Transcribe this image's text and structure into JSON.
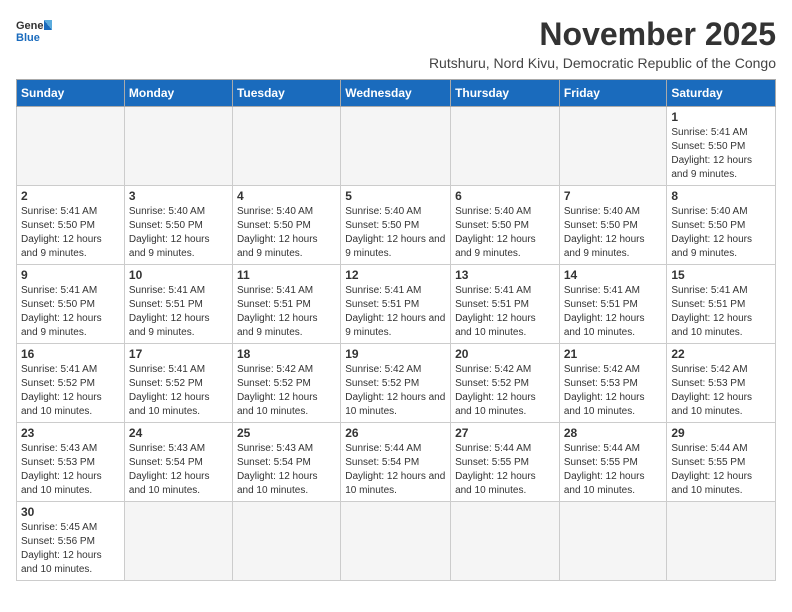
{
  "logo": {
    "line1": "General",
    "line2": "Blue"
  },
  "title": "November 2025",
  "subtitle": "Rutshuru, Nord Kivu, Democratic Republic of the Congo",
  "weekdays": [
    "Sunday",
    "Monday",
    "Tuesday",
    "Wednesday",
    "Thursday",
    "Friday",
    "Saturday"
  ],
  "weeks": [
    [
      {
        "day": "",
        "info": ""
      },
      {
        "day": "",
        "info": ""
      },
      {
        "day": "",
        "info": ""
      },
      {
        "day": "",
        "info": ""
      },
      {
        "day": "",
        "info": ""
      },
      {
        "day": "",
        "info": ""
      },
      {
        "day": "1",
        "info": "Sunrise: 5:41 AM\nSunset: 5:50 PM\nDaylight: 12 hours and 9 minutes."
      }
    ],
    [
      {
        "day": "2",
        "info": "Sunrise: 5:41 AM\nSunset: 5:50 PM\nDaylight: 12 hours and 9 minutes."
      },
      {
        "day": "3",
        "info": "Sunrise: 5:40 AM\nSunset: 5:50 PM\nDaylight: 12 hours and 9 minutes."
      },
      {
        "day": "4",
        "info": "Sunrise: 5:40 AM\nSunset: 5:50 PM\nDaylight: 12 hours and 9 minutes."
      },
      {
        "day": "5",
        "info": "Sunrise: 5:40 AM\nSunset: 5:50 PM\nDaylight: 12 hours and 9 minutes."
      },
      {
        "day": "6",
        "info": "Sunrise: 5:40 AM\nSunset: 5:50 PM\nDaylight: 12 hours and 9 minutes."
      },
      {
        "day": "7",
        "info": "Sunrise: 5:40 AM\nSunset: 5:50 PM\nDaylight: 12 hours and 9 minutes."
      },
      {
        "day": "8",
        "info": "Sunrise: 5:40 AM\nSunset: 5:50 PM\nDaylight: 12 hours and 9 minutes."
      }
    ],
    [
      {
        "day": "9",
        "info": "Sunrise: 5:41 AM\nSunset: 5:50 PM\nDaylight: 12 hours and 9 minutes."
      },
      {
        "day": "10",
        "info": "Sunrise: 5:41 AM\nSunset: 5:51 PM\nDaylight: 12 hours and 9 minutes."
      },
      {
        "day": "11",
        "info": "Sunrise: 5:41 AM\nSunset: 5:51 PM\nDaylight: 12 hours and 9 minutes."
      },
      {
        "day": "12",
        "info": "Sunrise: 5:41 AM\nSunset: 5:51 PM\nDaylight: 12 hours and 9 minutes."
      },
      {
        "day": "13",
        "info": "Sunrise: 5:41 AM\nSunset: 5:51 PM\nDaylight: 12 hours and 10 minutes."
      },
      {
        "day": "14",
        "info": "Sunrise: 5:41 AM\nSunset: 5:51 PM\nDaylight: 12 hours and 10 minutes."
      },
      {
        "day": "15",
        "info": "Sunrise: 5:41 AM\nSunset: 5:51 PM\nDaylight: 12 hours and 10 minutes."
      }
    ],
    [
      {
        "day": "16",
        "info": "Sunrise: 5:41 AM\nSunset: 5:52 PM\nDaylight: 12 hours and 10 minutes."
      },
      {
        "day": "17",
        "info": "Sunrise: 5:41 AM\nSunset: 5:52 PM\nDaylight: 12 hours and 10 minutes."
      },
      {
        "day": "18",
        "info": "Sunrise: 5:42 AM\nSunset: 5:52 PM\nDaylight: 12 hours and 10 minutes."
      },
      {
        "day": "19",
        "info": "Sunrise: 5:42 AM\nSunset: 5:52 PM\nDaylight: 12 hours and 10 minutes."
      },
      {
        "day": "20",
        "info": "Sunrise: 5:42 AM\nSunset: 5:52 PM\nDaylight: 12 hours and 10 minutes."
      },
      {
        "day": "21",
        "info": "Sunrise: 5:42 AM\nSunset: 5:53 PM\nDaylight: 12 hours and 10 minutes."
      },
      {
        "day": "22",
        "info": "Sunrise: 5:42 AM\nSunset: 5:53 PM\nDaylight: 12 hours and 10 minutes."
      }
    ],
    [
      {
        "day": "23",
        "info": "Sunrise: 5:43 AM\nSunset: 5:53 PM\nDaylight: 12 hours and 10 minutes."
      },
      {
        "day": "24",
        "info": "Sunrise: 5:43 AM\nSunset: 5:54 PM\nDaylight: 12 hours and 10 minutes."
      },
      {
        "day": "25",
        "info": "Sunrise: 5:43 AM\nSunset: 5:54 PM\nDaylight: 12 hours and 10 minutes."
      },
      {
        "day": "26",
        "info": "Sunrise: 5:44 AM\nSunset: 5:54 PM\nDaylight: 12 hours and 10 minutes."
      },
      {
        "day": "27",
        "info": "Sunrise: 5:44 AM\nSunset: 5:55 PM\nDaylight: 12 hours and 10 minutes."
      },
      {
        "day": "28",
        "info": "Sunrise: 5:44 AM\nSunset: 5:55 PM\nDaylight: 12 hours and 10 minutes."
      },
      {
        "day": "29",
        "info": "Sunrise: 5:44 AM\nSunset: 5:55 PM\nDaylight: 12 hours and 10 minutes."
      }
    ],
    [
      {
        "day": "30",
        "info": "Sunrise: 5:45 AM\nSunset: 5:56 PM\nDaylight: 12 hours and 10 minutes."
      },
      {
        "day": "",
        "info": ""
      },
      {
        "day": "",
        "info": ""
      },
      {
        "day": "",
        "info": ""
      },
      {
        "day": "",
        "info": ""
      },
      {
        "day": "",
        "info": ""
      },
      {
        "day": "",
        "info": ""
      }
    ]
  ]
}
